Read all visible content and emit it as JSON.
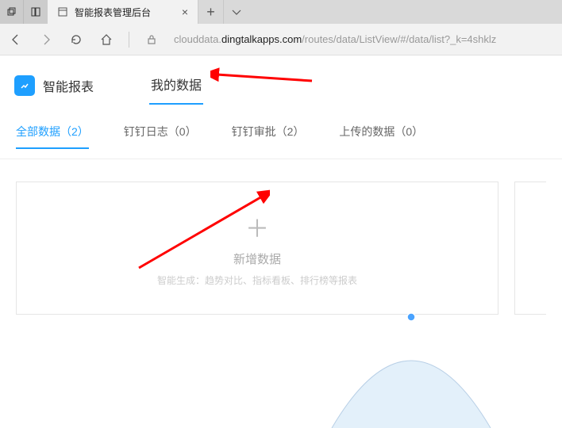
{
  "browser": {
    "tab_title": "智能报表管理后台",
    "url_prefix": "clouddata.",
    "url_host": "dingtalkapps.com",
    "url_path": "/routes/data/ListView/#/data/list?_k=4shklz"
  },
  "app": {
    "title": "智能报表",
    "top_tab": "我的数据"
  },
  "subtabs": [
    {
      "label": "全部数据（2）",
      "active": true
    },
    {
      "label": "钉钉日志（0）",
      "active": false
    },
    {
      "label": "钉钉审批（2）",
      "active": false
    },
    {
      "label": "上传的数据（0）",
      "active": false
    }
  ],
  "card": {
    "plus": "＋",
    "title": "新增数据",
    "subtitle": "智能生成：趋势对比、指标看板、排行榜等报表"
  }
}
